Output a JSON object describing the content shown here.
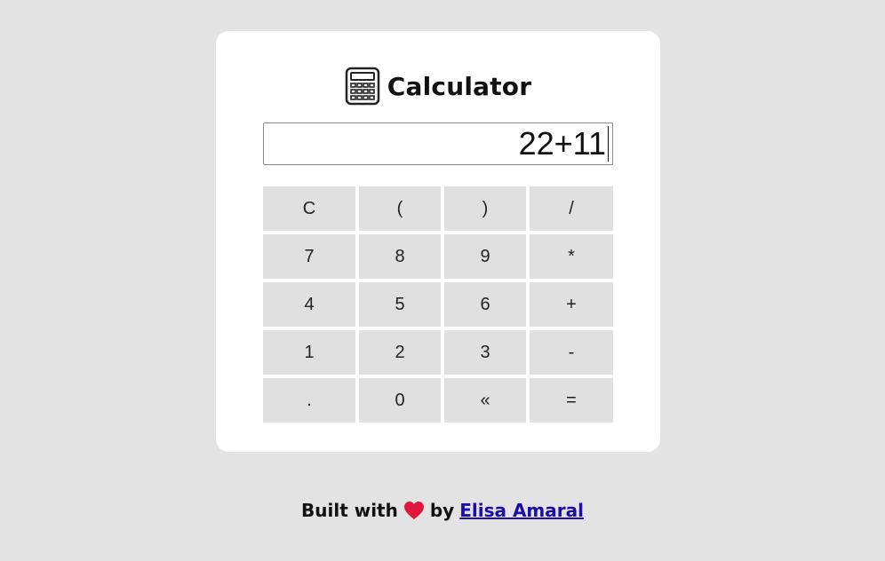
{
  "app": {
    "title": "Calculator",
    "icon": "calculator-icon"
  },
  "display": {
    "value": "22+11"
  },
  "keypad": {
    "keys": [
      [
        "C",
        "(",
        ")",
        "/"
      ],
      [
        "7",
        "8",
        "9",
        "*"
      ],
      [
        "4",
        "5",
        "6",
        "+"
      ],
      [
        "1",
        "2",
        "3",
        "-"
      ],
      [
        ".",
        "0",
        "«",
        "="
      ]
    ]
  },
  "footer": {
    "prefix": "Built with",
    "heart_icon": "heart-icon",
    "heart_color": "#e0163f",
    "by": "by",
    "author": "Elisa Amaral"
  },
  "colors": {
    "background": "#e4e3e4",
    "card": "#ffffff",
    "key": "#e0e0e0",
    "link": "#1a0dab"
  }
}
